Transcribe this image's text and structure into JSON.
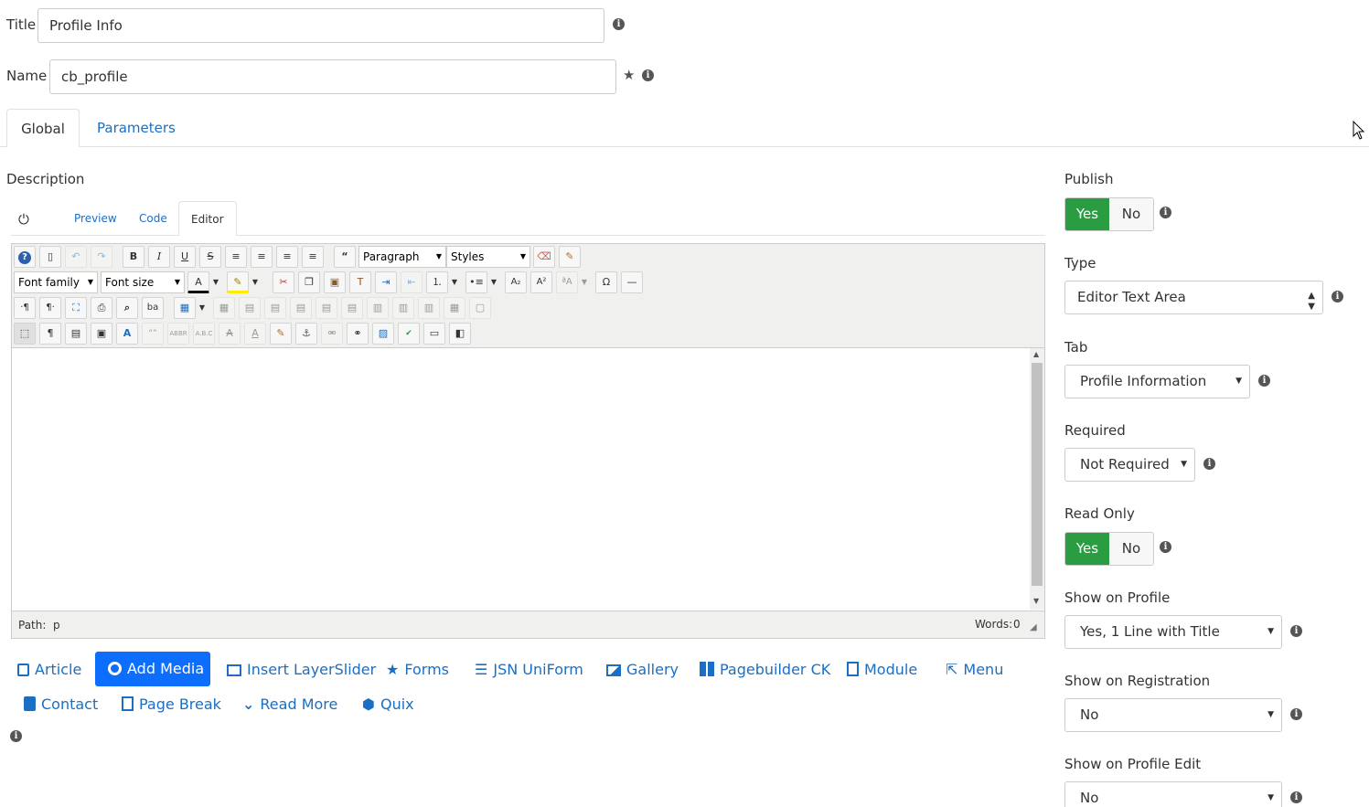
{
  "form": {
    "title_label": "Title",
    "title_value": "Profile Info",
    "name_label": "Name",
    "name_value": "cb_profile"
  },
  "tabs": [
    {
      "label": "Global"
    },
    {
      "label": "Parameters"
    }
  ],
  "description": {
    "label": "Description",
    "editor_tabs": [
      {
        "label": "Preview"
      },
      {
        "label": "Code"
      },
      {
        "label": "Editor"
      }
    ],
    "paragraph_select": "Paragraph",
    "styles_select": "Styles",
    "font_family": "Font family",
    "font_size": "Font size",
    "path_label": "Path:",
    "path_value": "p",
    "words_label": "Words:",
    "words_value": "0"
  },
  "editor_buttons": [
    {
      "label": "Article",
      "icon": "article-icon"
    },
    {
      "label": "Add Media",
      "icon": "camera-icon"
    },
    {
      "label": "Insert LayerSlider",
      "icon": "image-icon"
    },
    {
      "label": "Forms",
      "icon": "star-icon"
    },
    {
      "label": "JSN UniForm",
      "icon": "list-icon"
    },
    {
      "label": "Gallery",
      "icon": "picture-icon"
    },
    {
      "label": "Pagebuilder CK",
      "icon": "grid-icon"
    },
    {
      "label": "Module",
      "icon": "file-add-icon"
    },
    {
      "label": "Menu",
      "icon": "share-icon"
    },
    {
      "label": "Contact",
      "icon": "address-book-icon"
    },
    {
      "label": "Page Break",
      "icon": "copy-icon"
    },
    {
      "label": "Read More",
      "icon": "chevron-down-icon"
    },
    {
      "label": "Quix",
      "icon": "cube-icon"
    }
  ],
  "sidebar": {
    "publish": {
      "label": "Publish",
      "yes": "Yes",
      "no": "No"
    },
    "type": {
      "label": "Type",
      "value": "Editor Text Area"
    },
    "tab": {
      "label": "Tab",
      "value": "Profile Information"
    },
    "required": {
      "label": "Required",
      "value": "Not Required"
    },
    "read_only": {
      "label": "Read Only",
      "yes": "Yes",
      "no": "No"
    },
    "show_on_profile": {
      "label": "Show on Profile",
      "value": "Yes, 1 Line with Title"
    },
    "show_on_registration": {
      "label": "Show on Registration",
      "value": "No"
    },
    "show_on_profile_edit": {
      "label": "Show on Profile Edit",
      "value": "No"
    }
  },
  "colors": {
    "accent": "#1a6fc4",
    "success": "#2a9d42",
    "primary_button": "#0d6efd"
  }
}
